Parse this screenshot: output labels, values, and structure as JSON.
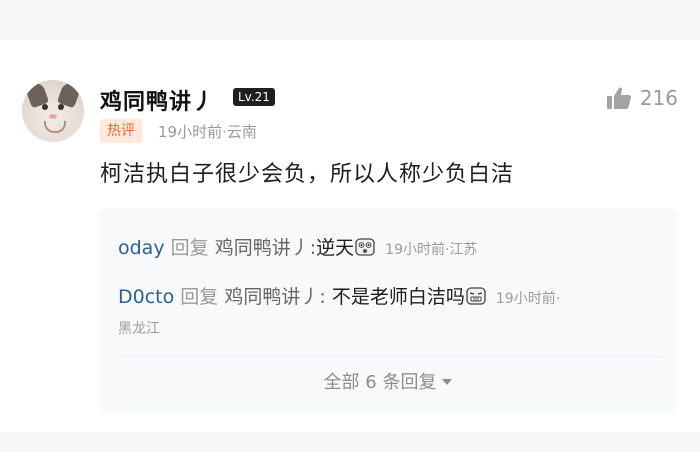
{
  "comment": {
    "username": "鸡同鸭讲丿",
    "level": "Lv.21",
    "like_count": "216",
    "hot_tag": "热评",
    "meta": "19小时前·云南",
    "text": "柯洁执白子很少会负，所以人称少负白洁"
  },
  "replies": [
    {
      "user": "oday",
      "verb": "回复",
      "target": "鸡同鸭讲丿:",
      "content": "逆天",
      "emoji": "shocked-face-emoji",
      "meta": "19小时前·江苏"
    },
    {
      "user": "D0cto",
      "verb": "回复",
      "target": "鸡同鸭讲丿:",
      "content": "不是老师白洁吗",
      "emoji": "grimace-face-emoji",
      "meta": "19小时前·",
      "meta_cont": "黑龙江"
    }
  ],
  "view_all": "全部 6 条回复",
  "colors": {
    "username_link": "#2d5f90",
    "hot_tag_bg": "#ffe8dc",
    "hot_tag_fg": "#e06d2e",
    "muted": "#9b9b9b"
  }
}
